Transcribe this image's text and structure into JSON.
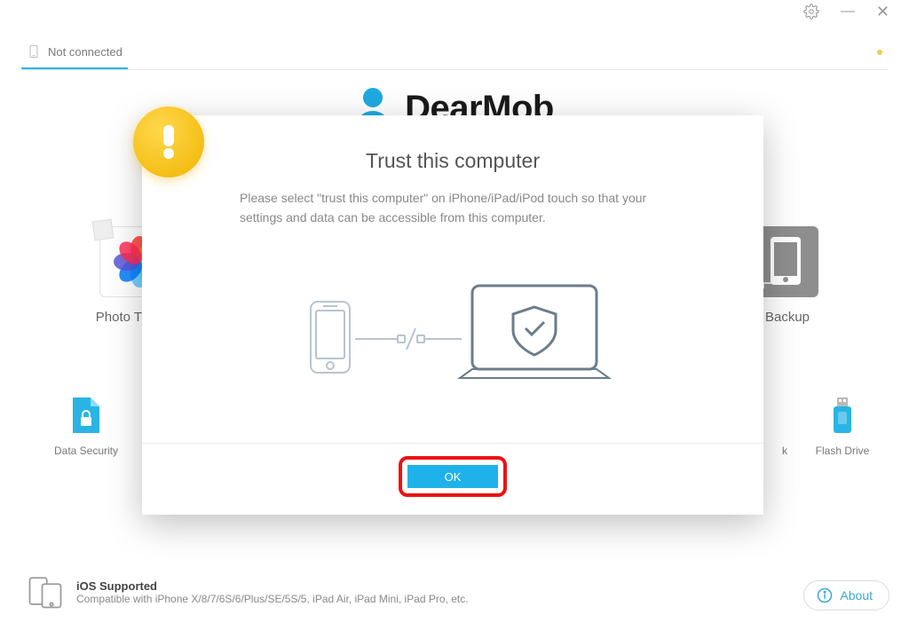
{
  "brand": {
    "name": "DearMob"
  },
  "titlebar": {
    "minimize": "—",
    "close": "✕"
  },
  "connection": {
    "status": "Not connected"
  },
  "modal": {
    "title": "Trust this computer",
    "body": "Please select \"trust this computer\" on iPhone/iPad/iPod touch so that your settings and data can be accessible from this computer.",
    "ok": "OK"
  },
  "tiles_large": {
    "photo": "Photo Transfer",
    "backup": "Backup"
  },
  "tiles_small": {
    "security": "Data Security",
    "flash": "Flash Drive",
    "hidden": "k"
  },
  "footer": {
    "title": "iOS Supported",
    "sub": "Compatible with iPhone X/8/7/6S/6/Plus/SE/5S/5, iPad Air, iPad Mini, iPad Pro, etc.",
    "about": "About"
  },
  "colors": {
    "accent": "#1fb1ea",
    "highlight_border": "#e11",
    "warning": "#f0b400"
  }
}
